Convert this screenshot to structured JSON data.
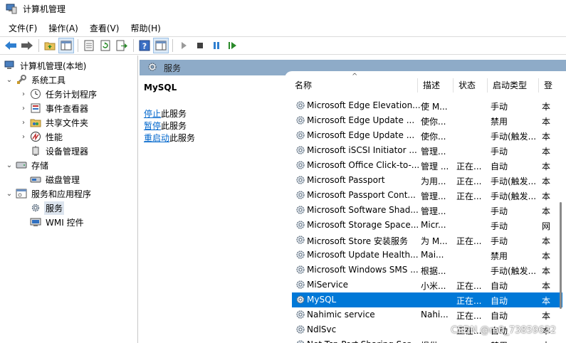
{
  "window": {
    "title": "计算机管理"
  },
  "menu": [
    "文件(F)",
    "操作(A)",
    "查看(V)",
    "帮助(H)"
  ],
  "toolbar": [
    "back-arrow-icon",
    "forward-arrow-icon",
    "up-folder-icon",
    "show-hide-tree-icon",
    "properties-icon",
    "refresh-icon",
    "export-icon",
    "help-icon",
    "show-hide-action-icon",
    "play-icon",
    "stop-icon",
    "pause-icon",
    "resume-icon"
  ],
  "tree": {
    "root": "计算机管理(本地)",
    "system_tools": "系统工具",
    "task_scheduler": "任务计划程序",
    "event_viewer": "事件查看器",
    "shared_folders": "共享文件夹",
    "performance": "性能",
    "device_manager": "设备管理器",
    "storage": "存储",
    "disk_management": "磁盘管理",
    "services_apps": "服务和应用程序",
    "services": "服务",
    "wmi": "WMI 控件"
  },
  "services_header": "服务",
  "detail": {
    "selected_service": "MySQL",
    "stop_link": "停止",
    "stop_suffix": "此服务",
    "pause_link": "暂停",
    "pause_suffix": "此服务",
    "restart_link": "重启动",
    "restart_suffix": "此服务"
  },
  "columns": [
    "名称",
    "描述",
    "状态",
    "启动类型",
    "登"
  ],
  "rows": [
    {
      "name": "Microsoft Edge Elevation...",
      "desc": "使 M...",
      "status": "",
      "startup": "手动",
      "logon": "本"
    },
    {
      "name": "Microsoft Edge Update ...",
      "desc": "使你...",
      "status": "",
      "startup": "禁用",
      "logon": "本"
    },
    {
      "name": "Microsoft Edge Update ...",
      "desc": "使你...",
      "status": "",
      "startup": "手动(触发...",
      "logon": "本"
    },
    {
      "name": "Microsoft iSCSI Initiator ...",
      "desc": "管理...",
      "status": "",
      "startup": "手动",
      "logon": "本"
    },
    {
      "name": "Microsoft Office Click-to-...",
      "desc": "管理 ...",
      "status": "正在...",
      "startup": "自动",
      "logon": "本"
    },
    {
      "name": "Microsoft Passport",
      "desc": "为用...",
      "status": "正在...",
      "startup": "手动(触发...",
      "logon": "本"
    },
    {
      "name": "Microsoft Passport Cont...",
      "desc": "管理...",
      "status": "正在...",
      "startup": "手动(触发...",
      "logon": "本"
    },
    {
      "name": "Microsoft Software Shad...",
      "desc": "管理...",
      "status": "",
      "startup": "手动",
      "logon": "本"
    },
    {
      "name": "Microsoft Storage Space...",
      "desc": "Micr...",
      "status": "",
      "startup": "手动",
      "logon": "网"
    },
    {
      "name": "Microsoft Store 安装服务",
      "desc": "为 M...",
      "status": "正在...",
      "startup": "手动",
      "logon": "本"
    },
    {
      "name": "Microsoft Update Health...",
      "desc": "Mai...",
      "status": "",
      "startup": "禁用",
      "logon": "本"
    },
    {
      "name": "Microsoft Windows SMS ...",
      "desc": "根据...",
      "status": "",
      "startup": "手动(触发...",
      "logon": "本"
    },
    {
      "name": "MiService",
      "desc": "小米...",
      "status": "正在...",
      "startup": "自动",
      "logon": "本"
    },
    {
      "name": "MySQL",
      "desc": "",
      "status": "正在...",
      "startup": "自动",
      "logon": "本"
    },
    {
      "name": "Nahimic service",
      "desc": "Nahi...",
      "status": "正在...",
      "startup": "自动",
      "logon": "本"
    },
    {
      "name": "NdlSvc",
      "desc": "",
      "status": "正在...",
      "startup": "自动",
      "logon": "本"
    },
    {
      "name": "Net Tcp Port Sharing Ser...",
      "desc": "提供...",
      "status": "",
      "startup": "禁用",
      "logon": "本"
    }
  ],
  "selected_row_index": 13,
  "watermark": "CSDN @m0_73859632",
  "colors": {
    "header_bar": "#8eabc8",
    "selection": "#0078d7",
    "link": "#0066cc"
  }
}
